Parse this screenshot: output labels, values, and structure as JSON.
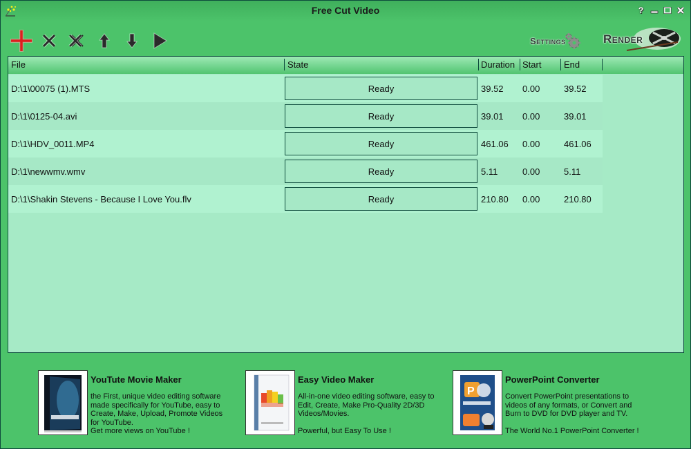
{
  "window": {
    "title": "Free Cut Video",
    "controls": [
      {
        "name": "help-button",
        "glyph": "?"
      },
      {
        "name": "minimize-button",
        "glyph": "▬"
      },
      {
        "name": "maximize-button",
        "glyph": "□"
      },
      {
        "name": "close-button",
        "glyph": "✕"
      }
    ]
  },
  "toolbar": {
    "buttons": [
      {
        "name": "add-file-button",
        "icon": "plus-icon",
        "color": "#e01e1e"
      },
      {
        "name": "remove-file-button",
        "icon": "x-icon"
      },
      {
        "name": "remove-all-button",
        "icon": "double-x-icon"
      },
      {
        "name": "move-up-button",
        "icon": "arrow-up-icon"
      },
      {
        "name": "move-down-button",
        "icon": "arrow-down-icon"
      },
      {
        "name": "play-button",
        "icon": "play-icon"
      }
    ],
    "settings_label": "Settings",
    "render_label": "Render"
  },
  "table": {
    "columns": [
      "File",
      "State",
      "Duration",
      "Start",
      "End"
    ],
    "rows": [
      {
        "file": "D:\\1\\00075 (1).MTS",
        "state": "Ready",
        "duration": "39.52",
        "start": "0.00",
        "end": "39.52"
      },
      {
        "file": "D:\\1\\0125-04.avi",
        "state": "Ready",
        "duration": "39.01",
        "start": "0.00",
        "end": "39.01"
      },
      {
        "file": "D:\\1\\HDV_0011.MP4",
        "state": "Ready",
        "duration": "461.06",
        "start": "0.00",
        "end": "461.06"
      },
      {
        "file": "D:\\1\\newwmv.wmv",
        "state": "Ready",
        "duration": "5.11",
        "start": "0.00",
        "end": "5.11"
      },
      {
        "file": "D:\\1\\Shakin Stevens - Because I Love You.flv",
        "state": "Ready",
        "duration": "210.80",
        "start": "0.00",
        "end": "210.80"
      }
    ]
  },
  "promos": [
    {
      "title": "YouTute Movie Maker",
      "desc": [
        "the First, unique video editing software",
        "made specifically for YouTube, easy to",
        "Create, Make, Upload, Promote Videos",
        "for YouTube."
      ],
      "tagline": "Get more views on YouTube !"
    },
    {
      "title": "Easy Video Maker",
      "desc": [
        "All-in-one video editing software, easy to",
        "Edit, Create, Make Pro-Quality 2D/3D",
        "Videos/Movies."
      ],
      "tagline": "Powerful, but Easy To Use !"
    },
    {
      "title": "PowerPoint Converter",
      "desc": [
        "Convert PowerPoint presentations to",
        "videos of any formats, or Convert and",
        "Burn to DVD for DVD player and TV."
      ],
      "tagline": "The World No.1 PowerPoint Converter !"
    }
  ],
  "colors": {
    "window_bg": "#4cc36a",
    "table_bg": "#a6eac6",
    "row_light": "#b0f2d0",
    "border": "#0d4a3c"
  }
}
